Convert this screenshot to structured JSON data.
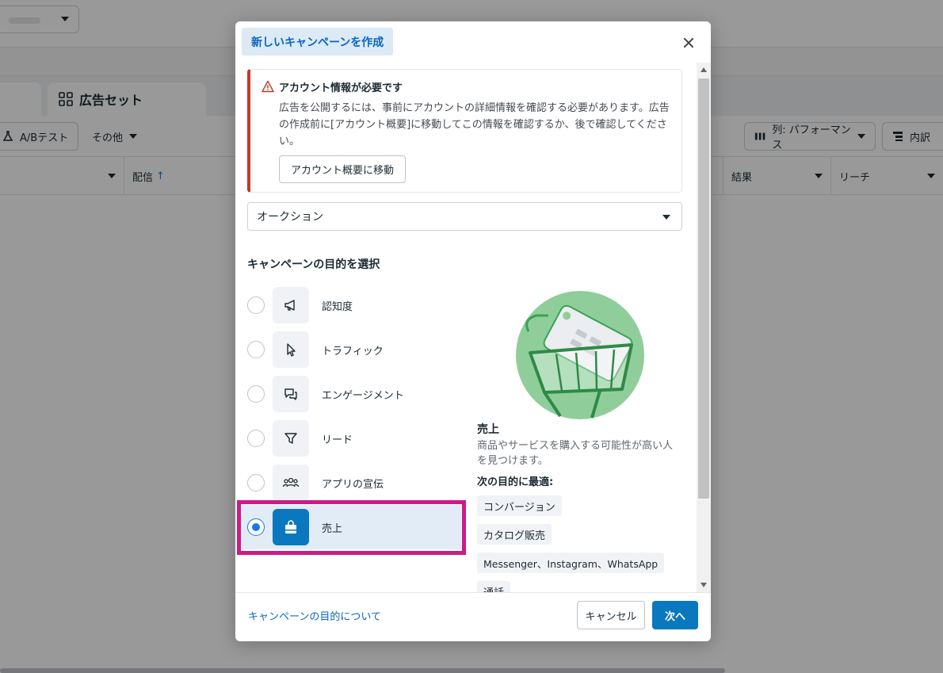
{
  "background": {
    "tab_adsets": "広告セット",
    "ab_test": "A/Bテスト",
    "other": "その他",
    "columns_btn": "列: パフォーマンス",
    "breakdown_btn": "内訳",
    "col_delivery": "配信",
    "col_results": "結果",
    "col_reach": "リーチ"
  },
  "modal": {
    "title": "新しいキャンペーンを作成",
    "alert": {
      "title": "アカウント情報が必要です",
      "body": "広告を公開するには、事前にアカウントの詳細情報を確認する必要があります。広告の作成前に[アカウント概要]に移動してこの情報を確認するか、後で確認してください。",
      "button": "アカウント概要に移動"
    },
    "buying_type": "オークション",
    "section_title": "キャンペーンの目的を選択",
    "objectives": [
      {
        "label": "認知度",
        "icon": "megaphone-icon",
        "selected": false
      },
      {
        "label": "トラフィック",
        "icon": "cursor-icon",
        "selected": false
      },
      {
        "label": "エンゲージメント",
        "icon": "chat-bubbles-icon",
        "selected": false
      },
      {
        "label": "リード",
        "icon": "funnel-icon",
        "selected": false
      },
      {
        "label": "アプリの宣伝",
        "icon": "people-icon",
        "selected": false
      },
      {
        "label": "売上",
        "icon": "shopping-bag-icon",
        "selected": true
      }
    ],
    "detail": {
      "title": "売上",
      "description": "商品やサービスを購入する可能性が高い人を見つけます。",
      "best_for_label": "次の目的に最適:",
      "chips": [
        "コンバージョン",
        "カタログ販売",
        "Messenger、Instagram、WhatsApp",
        "通話"
      ]
    },
    "footer": {
      "link": "キャンペーンの目的について",
      "cancel": "キャンセル",
      "next": "次へ"
    }
  },
  "colors": {
    "accent": "#1877f2",
    "primary_button": "#0a78be",
    "highlight": "#cc1b86",
    "alert_red": "#c43828",
    "illustration_green": "#8fce9a"
  }
}
